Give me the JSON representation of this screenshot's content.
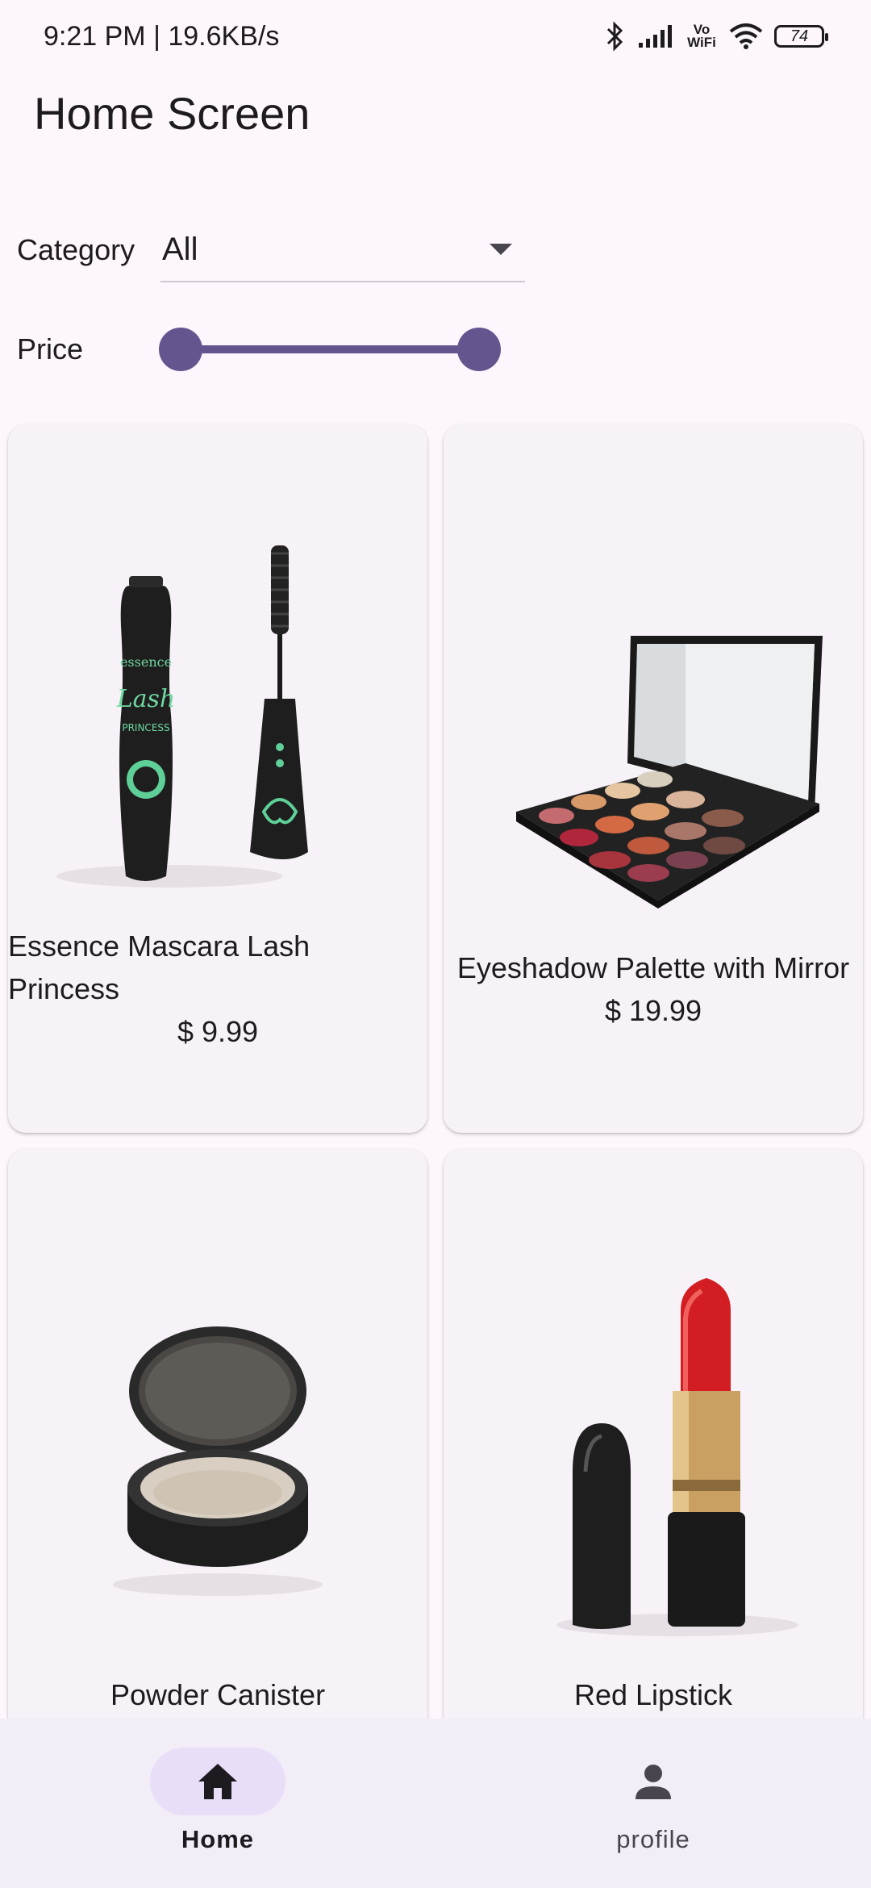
{
  "status_bar": {
    "time_speed": "9:21 PM | 19.6KB/s",
    "network_label": "Vo WiFi",
    "battery_level": "74"
  },
  "app_bar": {
    "title": "Home Screen"
  },
  "filters": {
    "category_label": "Category",
    "category_value": "All",
    "price_label": "Price",
    "price_range": {
      "min_fraction": 0,
      "max_fraction": 1
    }
  },
  "products": [
    {
      "title": "Essence Mascara Lash Princess",
      "price": "$ 9.99",
      "image": "mascara-image"
    },
    {
      "title": "Eyeshadow Palette with Mirror",
      "price": "$ 19.99",
      "image": "eyeshadow-palette-image"
    },
    {
      "title": "Powder Canister",
      "image": "powder-canister-image"
    },
    {
      "title": "Red Lipstick",
      "image": "red-lipstick-image"
    }
  ],
  "bottom_nav": {
    "items": [
      {
        "label": "Home",
        "icon": "home-icon",
        "selected": true
      },
      {
        "label": "profile",
        "icon": "person-icon",
        "selected": false
      }
    ]
  },
  "colors": {
    "background": "#fdf6fc",
    "accent": "#65558f",
    "card": "#f7f2f8",
    "nav_background": "#f3edf7",
    "nav_indicator": "#e8def8"
  }
}
